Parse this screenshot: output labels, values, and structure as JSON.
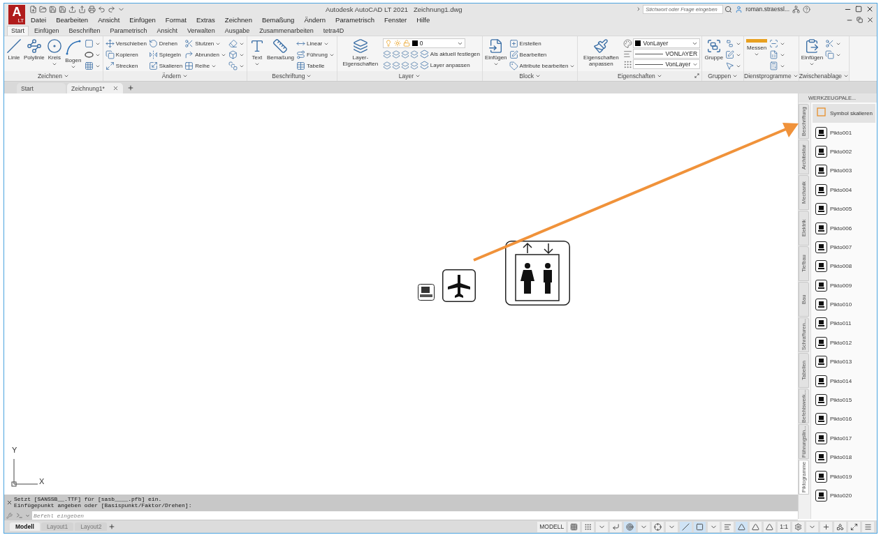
{
  "app": {
    "logo_letter": "A",
    "logo_sub": "LT",
    "title": "Autodesk AutoCAD LT 2021",
    "file": "Zeichnung1.dwg",
    "search": {
      "placeholder": "Stichwort oder Frage eingeben"
    },
    "user": "roman.straessl..."
  },
  "menu": [
    "Datei",
    "Bearbeiten",
    "Ansicht",
    "Einfügen",
    "Format",
    "Extras",
    "Zeichnen",
    "Bemaßung",
    "Ändern",
    "Parametrisch",
    "Fenster",
    "Hilfe"
  ],
  "ribbon_tabs": [
    {
      "label": "Start",
      "selected": true
    },
    {
      "label": "Einfügen",
      "selected": false
    },
    {
      "label": "Beschriften",
      "selected": false
    },
    {
      "label": "Parametrisch",
      "selected": false
    },
    {
      "label": "Ansicht",
      "selected": false
    },
    {
      "label": "Verwalten",
      "selected": false
    },
    {
      "label": "Ausgabe",
      "selected": false
    },
    {
      "label": "Zusammenarbeiten",
      "selected": false
    },
    {
      "label": "tetra4D",
      "selected": false
    }
  ],
  "panels": [
    {
      "title": "Zeichnen",
      "tools": [
        {
          "kind": "large",
          "label": "Linie"
        },
        {
          "kind": "large",
          "label": "Polylinie"
        },
        {
          "kind": "large-split",
          "label": "Kreis"
        },
        {
          "kind": "large-split",
          "label": "Bogen"
        },
        {
          "kind": "icon"
        },
        {
          "kind": "icon"
        },
        {
          "kind": "icon"
        }
      ]
    },
    {
      "title": "Ändern",
      "tools": [
        {
          "kind": "small",
          "label": "Verschieben"
        },
        {
          "kind": "small",
          "label": "Kopieren"
        },
        {
          "kind": "small",
          "label": "Strecken"
        },
        {
          "kind": "small",
          "label": "Drehen"
        },
        {
          "kind": "small",
          "label": "Spiegeln"
        },
        {
          "kind": "small",
          "label": "Skalieren"
        },
        {
          "kind": "small-split",
          "label": "Stutzen"
        },
        {
          "kind": "small-split",
          "label": "Abrunden"
        },
        {
          "kind": "small-split",
          "label": "Reihe"
        },
        {
          "kind": "icon"
        },
        {
          "kind": "icon"
        },
        {
          "kind": "icon"
        }
      ]
    },
    {
      "title": "Beschriftung",
      "tools": [
        {
          "kind": "large-split",
          "label": "Text"
        },
        {
          "kind": "large",
          "label": "Bemaßung"
        },
        {
          "kind": "small-split",
          "label": "Linear"
        },
        {
          "kind": "small-split",
          "label": "Führung"
        },
        {
          "kind": "small",
          "label": "Tabelle"
        }
      ]
    },
    {
      "title": "Layer",
      "tools": [
        {
          "kind": "large",
          "label": "Layer-Eigenschaften"
        },
        {
          "kind": "layer-dropdown",
          "value": "0"
        },
        {
          "kind": "layer-row",
          "label": "Als aktuell festlegen"
        },
        {
          "kind": "layer-row",
          "label": "Layer anpassen"
        }
      ]
    },
    {
      "title": "Block",
      "tools": [
        {
          "kind": "large-split",
          "label": "Einfügen"
        },
        {
          "kind": "small",
          "label": "Erstellen"
        },
        {
          "kind": "small",
          "label": "Bearbeiten"
        },
        {
          "kind": "small-split",
          "label": "Attribute bearbeiten"
        }
      ]
    },
    {
      "title": "Eigenschaften",
      "launcher": true,
      "tools": [
        {
          "kind": "large",
          "label": "Eigenschaften anpassen"
        },
        {
          "kind": "color-dropdown",
          "value": "VonLayer"
        },
        {
          "kind": "line-dropdown",
          "value": "VONLAYER"
        },
        {
          "kind": "line-dropdown",
          "value": "VonLayer"
        }
      ]
    },
    {
      "title": "Gruppen",
      "tools": [
        {
          "kind": "large",
          "label": "Gruppe"
        },
        {
          "kind": "icon"
        },
        {
          "kind": "icon"
        },
        {
          "kind": "icon"
        }
      ]
    },
    {
      "title": "Dienstprogramme",
      "tools": [
        {
          "kind": "large-split",
          "label": "Messen"
        },
        {
          "kind": "icon"
        },
        {
          "kind": "icon"
        },
        {
          "kind": "icon"
        }
      ]
    },
    {
      "title": "Zwischenablage",
      "tools": [
        {
          "kind": "large-split",
          "label": "Einfügen"
        },
        {
          "kind": "icon"
        },
        {
          "kind": "icon"
        }
      ]
    }
  ],
  "doc_tabs": [
    {
      "label": "Start",
      "selected": false
    },
    {
      "label": "Zeichnung1*",
      "selected": true
    }
  ],
  "canvas": {
    "ucs": {
      "y": "Y",
      "x": "X"
    }
  },
  "palette": {
    "title": "WERKZEUGPALE...",
    "tabs": [
      {
        "label": "Beschriftung",
        "selected": false
      },
      {
        "label": "Architektur",
        "selected": false
      },
      {
        "label": "Mechanik",
        "selected": false
      },
      {
        "label": "Elektrik",
        "selected": false
      },
      {
        "label": "Tiefbau",
        "selected": false
      },
      {
        "label": "Bau",
        "selected": false
      },
      {
        "label": "Schraffuren...",
        "selected": false
      },
      {
        "label": "Tabellen",
        "selected": false
      },
      {
        "label": "Befehlswerk...",
        "selected": false
      },
      {
        "label": "Führungslin...",
        "selected": false
      },
      {
        "label": "Piktogramme",
        "selected": true
      }
    ],
    "items": [
      {
        "kind": "scale",
        "label": "Symbol skalieren",
        "selected": true
      },
      {
        "kind": "pikto",
        "label": "Pikto001",
        "selected": false
      },
      {
        "kind": "pikto",
        "label": "Pikto002",
        "selected": false
      },
      {
        "kind": "pikto",
        "label": "Pikto003",
        "selected": false
      },
      {
        "kind": "pikto",
        "label": "Pikto004",
        "selected": false
      },
      {
        "kind": "pikto",
        "label": "Pikto005",
        "selected": false
      },
      {
        "kind": "pikto",
        "label": "Pikto006",
        "selected": false
      },
      {
        "kind": "pikto",
        "label": "Pikto007",
        "selected": false
      },
      {
        "kind": "pikto",
        "label": "Pikto008",
        "selected": false
      },
      {
        "kind": "pikto",
        "label": "Pikto009",
        "selected": false
      },
      {
        "kind": "pikto",
        "label": "Pikto010",
        "selected": false
      },
      {
        "kind": "pikto",
        "label": "Pikto011",
        "selected": false
      },
      {
        "kind": "pikto",
        "label": "Pikto012",
        "selected": false
      },
      {
        "kind": "pikto",
        "label": "Pikto013",
        "selected": false
      },
      {
        "kind": "pikto",
        "label": "Pikto014",
        "selected": false
      },
      {
        "kind": "pikto",
        "label": "Pikto015",
        "selected": false
      },
      {
        "kind": "pikto",
        "label": "Pikto016",
        "selected": false
      },
      {
        "kind": "pikto",
        "label": "Pikto017",
        "selected": false
      },
      {
        "kind": "pikto",
        "label": "Pikto018",
        "selected": false
      },
      {
        "kind": "pikto",
        "label": "Pikto019",
        "selected": false
      },
      {
        "kind": "pikto",
        "label": "Pikto020",
        "selected": false
      }
    ]
  },
  "command": {
    "history": [
      "Setzt [SANSSB__.TTF] für [sasb____.pfb] ein.",
      "Einfügepunkt angeben oder [Basispunkt/Faktor/Drehen]:"
    ],
    "placeholder": "Befehl eingeben"
  },
  "layout_tabs": [
    {
      "label": "Modell",
      "selected": true
    },
    {
      "label": "Layout1",
      "selected": false
    },
    {
      "label": "Layout2",
      "selected": false
    }
  ],
  "status": {
    "mode": "MODELL",
    "scale": "1:1"
  }
}
